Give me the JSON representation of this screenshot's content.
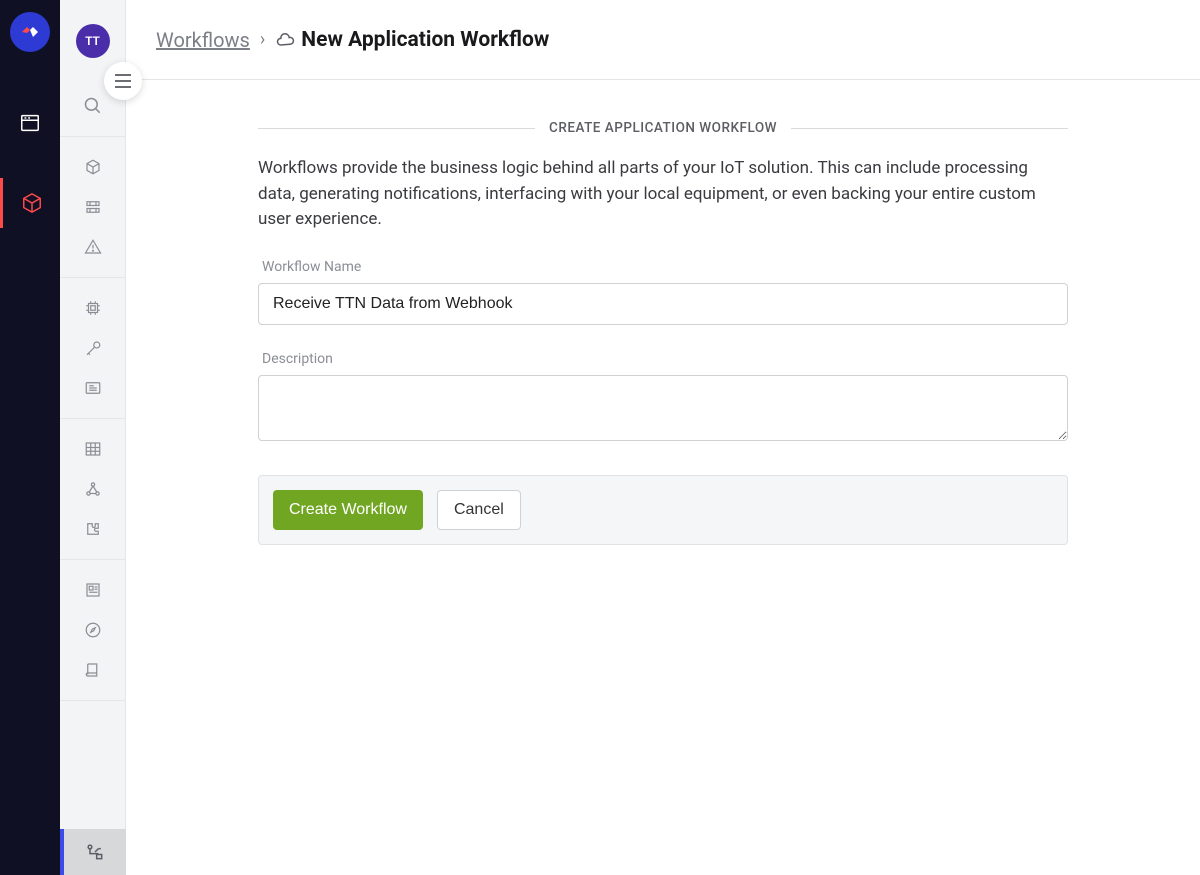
{
  "avatar_initials": "TT",
  "breadcrumb": {
    "parent": "Workflows",
    "separator": "›",
    "current": "New Application Workflow"
  },
  "section_title": "CREATE APPLICATION WORKFLOW",
  "intro_text": "Workflows provide the business logic behind all parts of your IoT solution. This can include processing data, generating notifications, interfacing with your local equipment, or even backing your entire custom user experience.",
  "form": {
    "name_label": "Workflow Name",
    "name_value": "Receive TTN Data from Webhook",
    "description_label": "Description",
    "description_value": ""
  },
  "actions": {
    "create": "Create Workflow",
    "cancel": "Cancel"
  }
}
